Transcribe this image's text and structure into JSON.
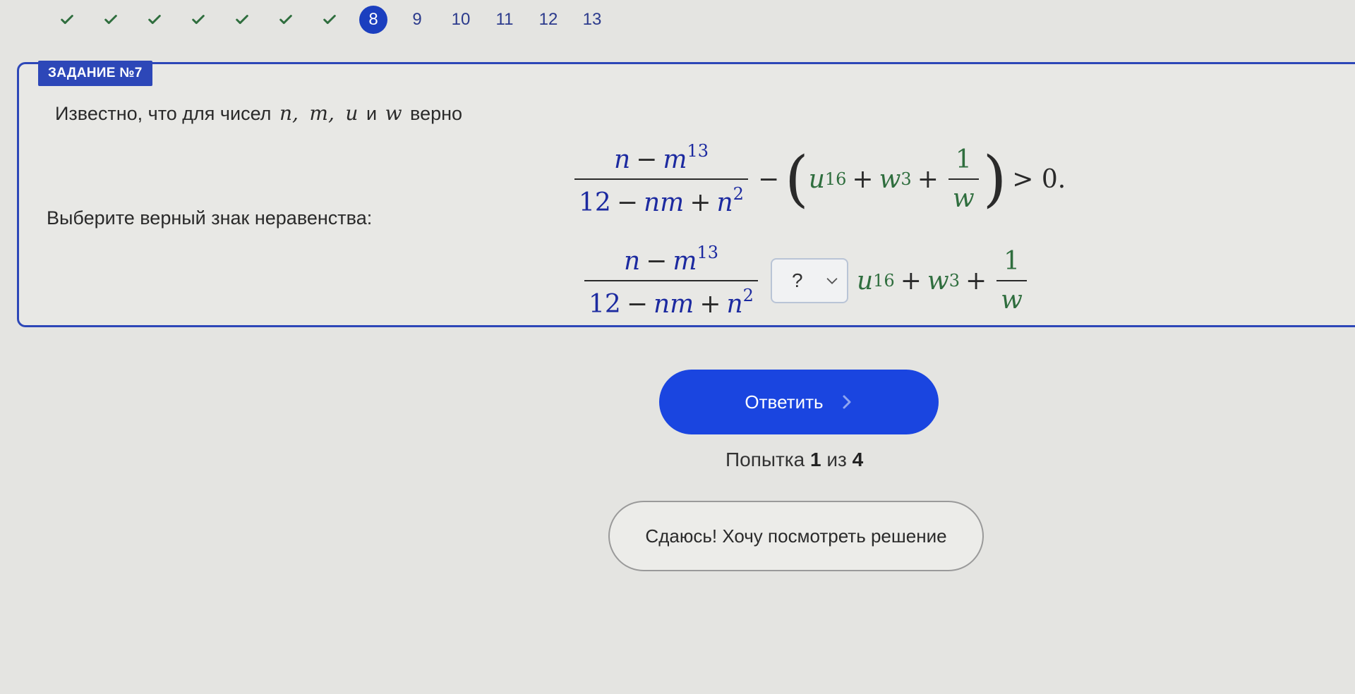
{
  "progress": {
    "completed_count": 7,
    "current": "8",
    "upcoming": [
      "9",
      "10",
      "11",
      "12",
      "13"
    ],
    "check_color": "#2f6e3e",
    "current_color": "#1b3fbf"
  },
  "task": {
    "badge": "ЗАДАНИЕ №7",
    "intro_text": "Известно, что для чисел",
    "vars": [
      "n,",
      "m,",
      "u"
    ],
    "and_word": "и",
    "last_var": "w",
    "verb": "верно",
    "choose_text": "Выберите верный знак неравенства:",
    "formula": {
      "num_n": "n",
      "num_minus": "−",
      "num_m": "m",
      "num_m_exp": "13",
      "den_12": "12",
      "den_minus": "−",
      "den_nm": "nm",
      "den_plus": "+",
      "den_n": "n",
      "den_n_exp": "2",
      "minus": "−",
      "u": "u",
      "u_exp": "16",
      "plus1": "+",
      "w": "w",
      "w_exp": "3",
      "plus2": "+",
      "one": "1",
      "w_den": "w",
      "gt_zero": "> 0."
    },
    "sign_select": {
      "value": "?"
    }
  },
  "answer_button": {
    "label": "Ответить"
  },
  "attempt": {
    "prefix": "Попытка",
    "current": "1",
    "of_word": "из",
    "total": "4"
  },
  "give_up_button": {
    "label": "Сдаюсь! Хочу посмотреть решение"
  },
  "colors": {
    "accent": "#1a45e0",
    "card_border": "#2d47b8",
    "math_blue": "#1c2aa0",
    "math_green": "#2f6e3e"
  }
}
